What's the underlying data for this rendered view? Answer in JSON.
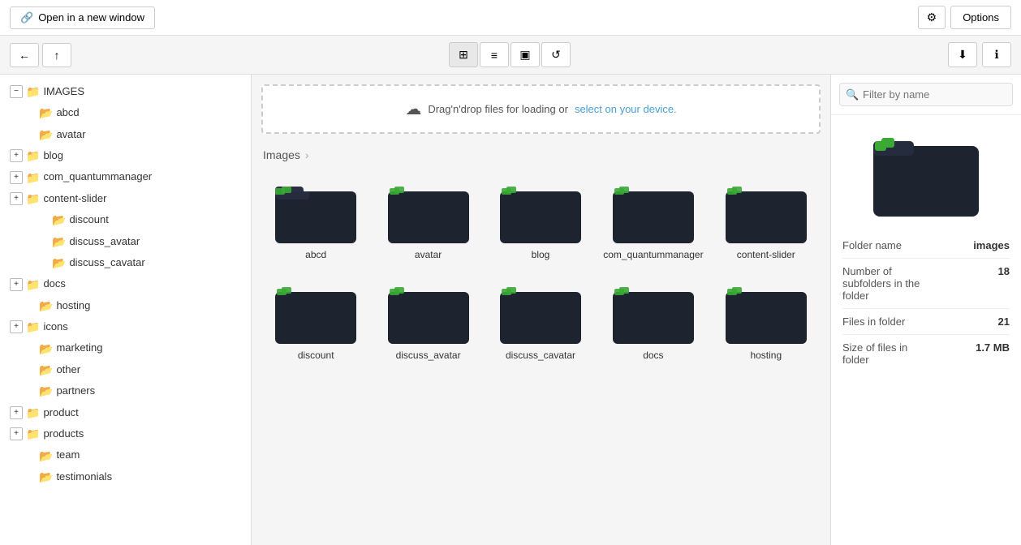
{
  "topbar": {
    "open_new_window_label": "Open in a new window",
    "link_icon": "🔗",
    "gear_icon": "⚙",
    "options_label": "Options"
  },
  "toolbar": {
    "back_icon": "←",
    "up_icon": "↑",
    "grid_icon": "⊞",
    "list_icon": "≡",
    "folder_icon": "▣",
    "refresh_icon": "↺",
    "download_icon": "⬇",
    "info_icon": "ℹ"
  },
  "dropzone": {
    "text": "Drag'n'drop files for loading or",
    "select_text": "select on your device.",
    "cloud_icon": "☁"
  },
  "breadcrumb": {
    "label": "Images",
    "chevron": "›"
  },
  "sidebar": {
    "root": "IMAGES",
    "items": [
      {
        "label": "abcd",
        "level": 2,
        "type": "folder",
        "expandable": false
      },
      {
        "label": "avatar",
        "level": 2,
        "type": "folder",
        "expandable": false
      },
      {
        "label": "blog",
        "level": 1,
        "type": "folder",
        "expandable": true
      },
      {
        "label": "com_quantummanager",
        "level": 1,
        "type": "folder",
        "expandable": true
      },
      {
        "label": "content-slider",
        "level": 1,
        "type": "folder",
        "expandable": true
      },
      {
        "label": "discount",
        "level": 3,
        "type": "folder",
        "expandable": false
      },
      {
        "label": "discuss_avatar",
        "level": 3,
        "type": "folder",
        "expandable": false
      },
      {
        "label": "discuss_cavatar",
        "level": 3,
        "type": "folder",
        "expandable": false
      },
      {
        "label": "docs",
        "level": 1,
        "type": "folder",
        "expandable": true
      },
      {
        "label": "hosting",
        "level": 2,
        "type": "folder",
        "expandable": false
      },
      {
        "label": "icons",
        "level": 1,
        "type": "folder",
        "expandable": true
      },
      {
        "label": "marketing",
        "level": 2,
        "type": "folder",
        "expandable": false
      },
      {
        "label": "other",
        "level": 2,
        "type": "folder",
        "expandable": false
      },
      {
        "label": "partners",
        "level": 2,
        "type": "folder",
        "expandable": false
      },
      {
        "label": "product",
        "level": 1,
        "type": "folder",
        "expandable": true
      },
      {
        "label": "products",
        "level": 1,
        "type": "folder",
        "expandable": true
      },
      {
        "label": "team",
        "level": 2,
        "type": "folder",
        "expandable": false
      },
      {
        "label": "testimonials",
        "level": 2,
        "type": "folder",
        "expandable": false
      }
    ]
  },
  "grid_items": [
    {
      "label": "abcd"
    },
    {
      "label": "avatar"
    },
    {
      "label": "blog"
    },
    {
      "label": "com_quantummanager"
    },
    {
      "label": "content-slider"
    },
    {
      "label": "discount"
    },
    {
      "label": "discuss_avatar"
    },
    {
      "label": "discuss_cavatar"
    },
    {
      "label": "docs"
    },
    {
      "label": "hosting"
    }
  ],
  "right_panel": {
    "filter_placeholder": "Filter by name",
    "folder_name_label": "Folder name",
    "folder_name_value": "images",
    "subfolders_label": "Number of subfolders in the folder",
    "subfolders_value": "18",
    "files_label": "Files in folder",
    "files_value": "21",
    "size_label": "Size of files in folder",
    "size_value": "1.7 MB"
  }
}
